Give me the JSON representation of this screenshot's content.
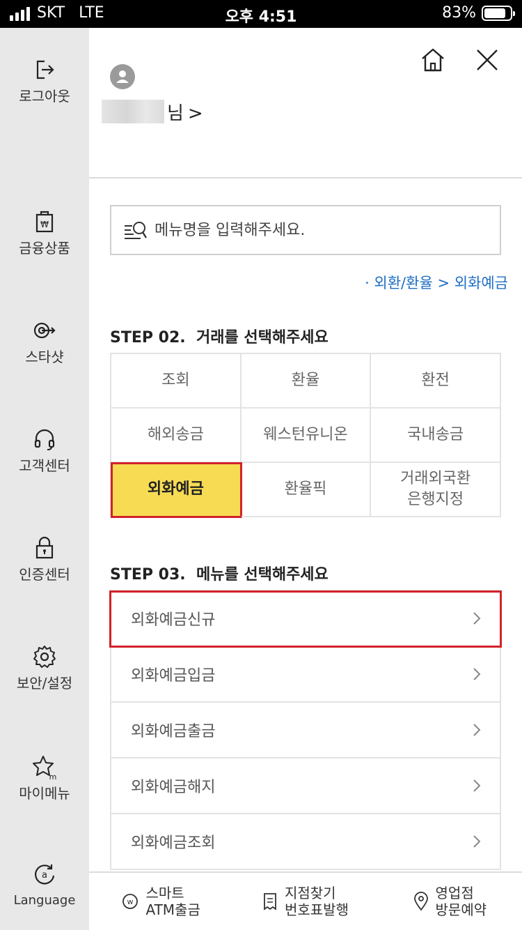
{
  "status_bar": {
    "carrier": "SKT",
    "network": "LTE",
    "time": "오후 4:51",
    "battery": "83%",
    "battery_level": 0.83
  },
  "sidebar": {
    "items": [
      {
        "label": "로그아웃",
        "icon": "logout-icon"
      },
      {
        "label": "금융상품",
        "icon": "bag-won-icon"
      },
      {
        "label": "스타샷",
        "icon": "target-arrow-icon"
      },
      {
        "label": "고객센터",
        "icon": "headset-icon"
      },
      {
        "label": "인증센터",
        "icon": "lock-icon"
      },
      {
        "label": "보안/설정",
        "icon": "gear-icon"
      },
      {
        "label": "마이메뉴",
        "icon": "star-m-icon"
      },
      {
        "label": "Language",
        "icon": "language-icon"
      }
    ]
  },
  "header": {
    "user_suffix": "님",
    "user_chevron": ">"
  },
  "search": {
    "placeholder": "메뉴명을 입력해주세요."
  },
  "breadcrumb": "· 외환/환율 > 외화예금",
  "step2": {
    "title": "STEP 02.",
    "subtitle": "거래를 선택해주세요",
    "options": [
      "조회",
      "환율",
      "환전",
      "해외송금",
      "웨스턴유니온",
      "국내송금",
      "외화예금",
      "환율픽",
      "거래외국환\n은행지정"
    ],
    "selected": "외화예금"
  },
  "step3": {
    "title": "STEP 03.",
    "subtitle": "메뉴를 선택해주세요",
    "items": [
      "외화예금신규",
      "외화예금입금",
      "외화예금출금",
      "외화예금해지",
      "외화예금조회"
    ],
    "selected": "외화예금신규"
  },
  "bottom_bar": [
    {
      "line1": "스마트",
      "line2": "ATM출금",
      "icon": "won-circle-icon"
    },
    {
      "line1": "지점찾기",
      "line2": "번호표발행",
      "icon": "ticket-icon"
    },
    {
      "line1": "영업점",
      "line2": "방문예약",
      "icon": "location-pin-icon"
    }
  ],
  "colors": {
    "accent_yellow": "#f7dc53",
    "highlight_red": "#d2222a",
    "link_blue": "#1f6fc4"
  }
}
